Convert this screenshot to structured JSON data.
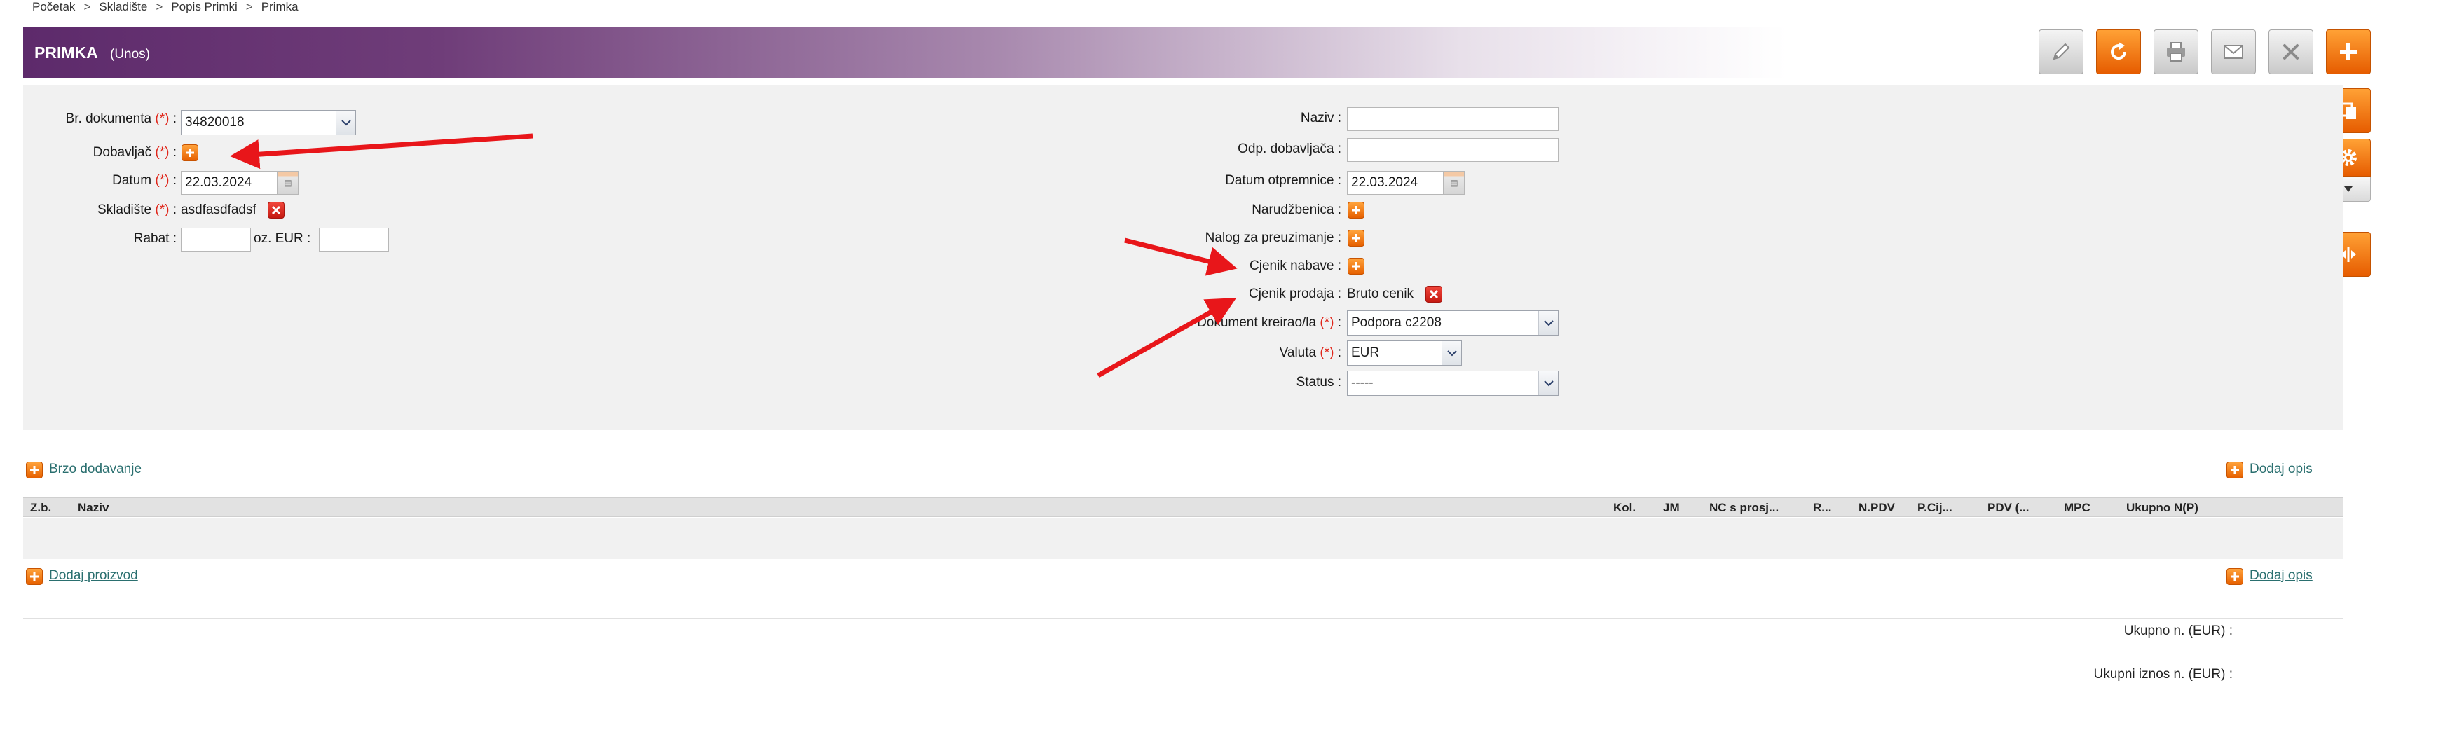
{
  "breadcrumb": [
    "Početak",
    "Skladište",
    "Popis Primki",
    "Primka"
  ],
  "breadcrumb_separator": ">",
  "header": {
    "title": "PRIMKA",
    "subtitle": "(Unos)"
  },
  "toolbar": {
    "edit": "pencil-icon",
    "refresh": "refresh-icon",
    "print": "printer-icon",
    "email": "envelope-icon",
    "close": "close-icon",
    "add": "plus-icon",
    "copy": "copy-icon",
    "settings": "gear-icon",
    "split": "split-arrows-icon"
  },
  "form_left": {
    "broj_dokumenta": {
      "label": "Br. dokumenta",
      "required": "(*)",
      "value": "34820018"
    },
    "dobavljac": {
      "label": "Dobavljač",
      "required": "(*)"
    },
    "datum": {
      "label": "Datum",
      "required": "(*)",
      "value": "22.03.2024"
    },
    "skladiste": {
      "label": "Skladište",
      "required": "(*)",
      "value": "asdfasdfadsf"
    },
    "rabat": {
      "label": "Rabat :",
      "oz_label": "oz. EUR :",
      "value": "",
      "eur_value": ""
    }
  },
  "form_right": {
    "naziv": {
      "label": "Naziv :",
      "value": ""
    },
    "odp_dobavljaca": {
      "label": "Odp. dobavljača :",
      "value": ""
    },
    "datum_otpremnice": {
      "label": "Datum otpremnice :",
      "value": "22.03.2024"
    },
    "narudzbenica": {
      "label": "Narudžbenica :"
    },
    "nalog": {
      "label": "Nalog za preuzimanje :"
    },
    "cjenik_nabave": {
      "label": "Cjenik nabave :"
    },
    "cjenik_prodaja": {
      "label": "Cjenik prodaja :",
      "value": "Bruto cenik"
    },
    "dokument_kreirao": {
      "label": "Dokument kreirao/la",
      "required": "(*)",
      "value": "Podpora c2208"
    },
    "valuta": {
      "label": "Valuta",
      "required": "(*)",
      "value": "EUR"
    },
    "status": {
      "label": "Status :",
      "value": "-----"
    }
  },
  "links": {
    "brzo_dodavanje": "Brzo dodavanje",
    "dodaj_opis": "Dodaj opis",
    "dodaj_proizvod": "Dodaj proizvod"
  },
  "grid": {
    "columns": [
      "Z.b.",
      "Naziv",
      "Kol.",
      "JM",
      "NC s prosj...",
      "R...",
      "N.PDV",
      "P.Cij...",
      "PDV (...",
      "MPC",
      "Ukupno N(P)"
    ]
  },
  "totals": {
    "ukupno_n": "Ukupno n. (EUR) :",
    "ukupni_iznos": "Ukupni iznos n. (EUR) :"
  },
  "colors": {
    "accent_orange": "#f07d00",
    "header_purple": "#5d2a6b",
    "required_red": "#e0261a",
    "annotation_red": "#e8161a",
    "link": "#2a6f6f"
  }
}
